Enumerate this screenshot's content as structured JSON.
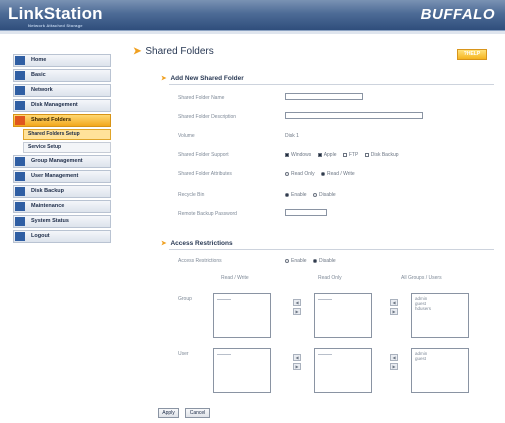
{
  "header": {
    "logo": "LinkStation",
    "logo_sub": "Network Attached Storage",
    "brand": "BUFFALO"
  },
  "sidebar": {
    "items": [
      {
        "label": "Home",
        "active": false
      },
      {
        "label": "Basic",
        "active": false
      },
      {
        "label": "Network",
        "active": false
      },
      {
        "label": "Disk Management",
        "active": false
      },
      {
        "label": "Shared Folders",
        "active": true
      },
      {
        "label": "Shared Folders Setup",
        "sub": true,
        "active": true
      },
      {
        "label": "Service Setup",
        "sub": true,
        "active": false
      },
      {
        "label": "Group Management",
        "active": false
      },
      {
        "label": "User Management",
        "active": false
      },
      {
        "label": "Disk Backup",
        "active": false
      },
      {
        "label": "Maintenance",
        "active": false
      },
      {
        "label": "System Status",
        "active": false
      },
      {
        "label": "Logout",
        "active": false
      }
    ]
  },
  "main": {
    "title": "Shared Folders",
    "help_label": "?HELP",
    "add_section": {
      "title": "Add New Shared Folder",
      "folder_name_label": "Shared Folder Name",
      "folder_name_value": "",
      "folder_desc_label": "Shared Folder Description",
      "folder_desc_value": "",
      "volume_label": "Volume",
      "volume_value": "Disk 1",
      "support_label": "Shared Folder Support",
      "support_options": [
        {
          "label": "Windows",
          "checked": true
        },
        {
          "label": "Apple",
          "checked": true
        },
        {
          "label": "FTP",
          "checked": false
        },
        {
          "label": "Disk Backup",
          "checked": false
        }
      ],
      "attributes_label": "Shared Folder Attributes",
      "attributes_options": [
        {
          "label": "Read Only",
          "selected": false
        },
        {
          "label": "Read / Write",
          "selected": true
        }
      ],
      "recycle_label": "Recycle Bin",
      "recycle_options": [
        {
          "label": "Enable",
          "selected": true
        },
        {
          "label": "Disable",
          "selected": false
        }
      ],
      "remote_backup_label": "Remote Backup Password",
      "remote_backup_value": ""
    },
    "access_section": {
      "title": "Access Restrictions",
      "restrictions_label": "Access Restrictions",
      "restrictions_options": [
        {
          "label": "Enable",
          "selected": false
        },
        {
          "label": "Disable",
          "selected": true
        }
      ],
      "col_read_write": "Read / Write",
      "col_read_only": "Read Only",
      "col_all": "All Groups / Users",
      "group_label": "Group",
      "user_label": "User",
      "group_all": [
        "admin",
        "guest",
        "hdusers"
      ],
      "user_all": [
        "admin",
        "guest"
      ]
    },
    "apply_label": "Apply",
    "cancel_label": "Cancel"
  }
}
